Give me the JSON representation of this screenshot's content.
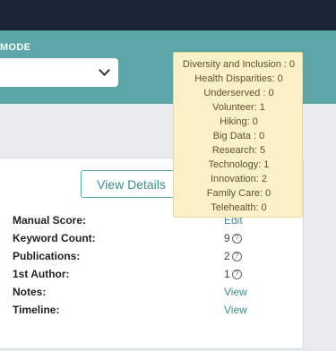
{
  "header": {
    "mode_label": "MODE"
  },
  "card": {
    "view_details_label": "View Details",
    "rows": [
      {
        "label": "Manual Score:",
        "value": "Edit"
      },
      {
        "label": "Keyword Count:",
        "value": "9"
      },
      {
        "label": "Publications:",
        "value": "2"
      },
      {
        "label": "1st Author:",
        "value": "1"
      },
      {
        "label": "Notes:",
        "value": "View"
      },
      {
        "label": "Timeline:",
        "value": "View"
      }
    ]
  },
  "tooltip": {
    "lines": [
      "Diversity and Inclusion : 0",
      "Health Disparities: 0",
      "Underserved : 0",
      "Volunteer: 1",
      "Hiking: 0",
      "Big Data : 0",
      "Research: 5",
      "Technology: 1",
      "Innovation: 2",
      "Family Care: 0",
      "Telehealth: 0"
    ]
  },
  "icons": {
    "select_chevron": "chevron-down-icon",
    "help": "question-circle-icon"
  },
  "colors": {
    "topbar": "#1b2535",
    "accent": "#5ba6a6",
    "tooltip_bg": "#fcf1c6",
    "link": "#3f8d8d"
  }
}
